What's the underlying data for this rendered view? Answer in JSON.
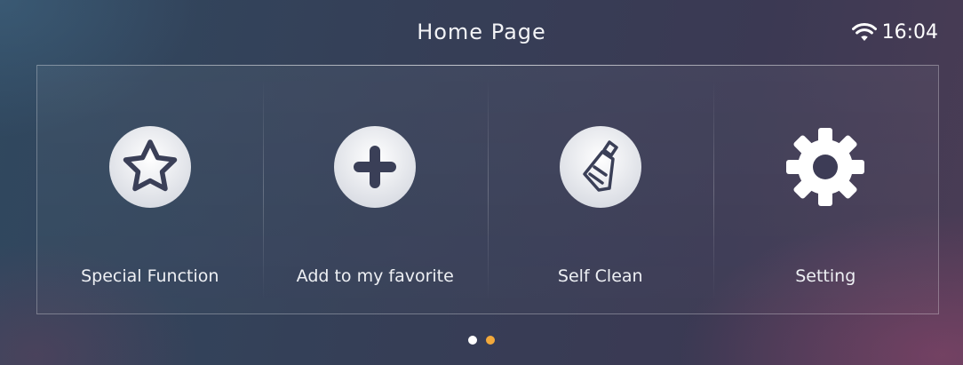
{
  "header": {
    "title": "Home Page",
    "time": "16:04",
    "wifi_icon": "wifi-icon"
  },
  "tiles": [
    {
      "label": "Special Function",
      "icon": "star-icon"
    },
    {
      "label": "Add to my favorite",
      "icon": "plus-icon"
    },
    {
      "label": "Self Clean",
      "icon": "brush-icon"
    },
    {
      "label": "Setting",
      "icon": "gear-icon"
    }
  ],
  "pager": {
    "pages": 2,
    "active_page": 2,
    "inactive_color": "#ffffff",
    "active_color": "#f2a93b"
  },
  "colors": {
    "icon_fill": "#ffffff",
    "icon_glyph": "#3a3f57"
  }
}
